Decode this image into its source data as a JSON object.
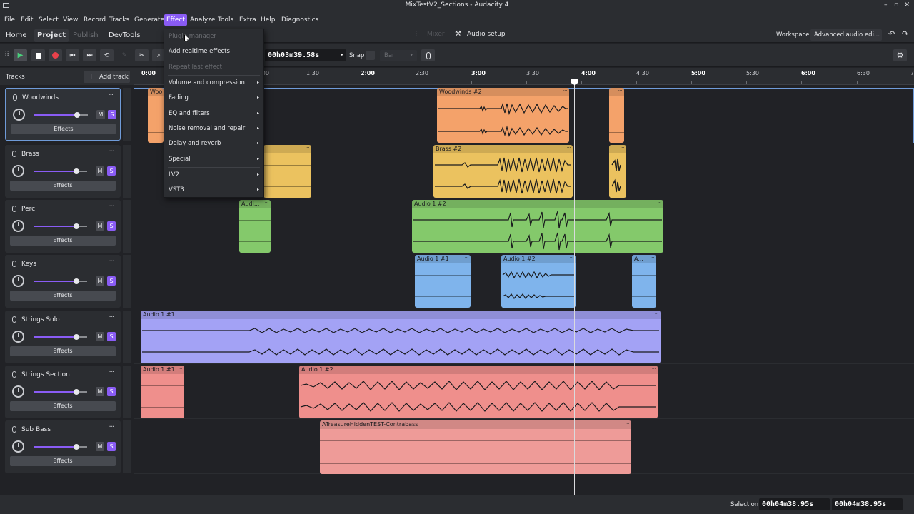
{
  "window": {
    "title": "MixTestV2_Sections - Audacity 4"
  },
  "menu": [
    "File",
    "Edit",
    "Select",
    "View",
    "Record",
    "Tracks",
    "Generate",
    "Effect",
    "Analyze",
    "Tools",
    "Extra",
    "Help",
    "Diagnostics"
  ],
  "nav": {
    "tabs": [
      "Home",
      "Project",
      "Publish",
      "DevTools"
    ],
    "mixer": "Mixer",
    "audio_setup": "Audio setup",
    "workspace_label": "Workspace",
    "workspace_value": "Advanced audio edi..."
  },
  "toolbar": {
    "time": "00h03m39.58s",
    "snap_label": "Snap",
    "snap_value": "Bar"
  },
  "tracks_header": {
    "label": "Tracks",
    "add_track": "Add track"
  },
  "ruler": {
    "labels": [
      "0:00",
      "1:00",
      "1:30",
      "2:00",
      "2:30",
      "3:00",
      "3:30",
      "4:00",
      "4:30",
      "5:00",
      "5:30",
      "6:00",
      "6:30",
      "7"
    ]
  },
  "tracks": [
    {
      "name": "Woodwinds",
      "mute": "M",
      "solo": "S",
      "effects": "Effects",
      "volume": 0.8
    },
    {
      "name": "Brass",
      "mute": "M",
      "solo": "S",
      "effects": "Effects",
      "volume": 0.8
    },
    {
      "name": "Perc",
      "mute": "M",
      "solo": "S",
      "effects": "Effects",
      "volume": 0.8
    },
    {
      "name": "Keys",
      "mute": "M",
      "solo": "S",
      "effects": "Effects",
      "volume": 0.8
    },
    {
      "name": "Strings Solo",
      "mute": "M",
      "solo": "S",
      "effects": "Effects",
      "volume": 0.8
    },
    {
      "name": "Strings Section",
      "mute": "M",
      "solo": "S",
      "effects": "Effects",
      "volume": 0.8
    },
    {
      "name": "Sub Bass",
      "mute": "M",
      "solo": "S",
      "effects": "Effects",
      "volume": 0.8
    }
  ],
  "clips": {
    "woodwinds_1": "Woo",
    "woodwinds_2": "Woodwinds #2",
    "brass_2": "Brass #2",
    "perc_1": "Audi...",
    "perc_2": "Audio 1 #2",
    "keys_1": "Audio 1 #1",
    "keys_2": "Audio 1 #2",
    "keys_3": "A...",
    "strings_solo_1": "Audio 1 #1",
    "strings_section_1": "Audio 1 #1",
    "strings_section_2": "Audio 1 #2",
    "sub_bass_1": "ATreasureHiddenTEST-Contrabass"
  },
  "clip_colors": {
    "woodwinds": "#f4a26a",
    "brass": "#ebc25f",
    "perc": "#84c96b",
    "keys": "#7fb4ec",
    "strings_solo": "#a3a2f5",
    "strings_section": "#ef8f8c",
    "sub_bass": "#ee9b98"
  },
  "effect_menu": {
    "items": [
      {
        "label": "Plugin manager",
        "disabled": true,
        "submenu": false
      },
      {
        "label": "Add realtime effects",
        "disabled": false,
        "submenu": false
      },
      {
        "label": "Repeat last effect",
        "disabled": true,
        "submenu": false
      },
      {
        "label": "Volume and compression",
        "disabled": false,
        "submenu": true
      },
      {
        "label": "Fading",
        "disabled": false,
        "submenu": true
      },
      {
        "label": "EQ and filters",
        "disabled": false,
        "submenu": true
      },
      {
        "label": "Noise removal and repair",
        "disabled": false,
        "submenu": true
      },
      {
        "label": "Delay and reverb",
        "disabled": false,
        "submenu": true
      },
      {
        "label": "Special",
        "disabled": false,
        "submenu": true
      },
      {
        "label": "LV2",
        "disabled": false,
        "submenu": true
      },
      {
        "label": "VST3",
        "disabled": false,
        "submenu": true
      }
    ]
  },
  "status": {
    "selection_label": "Selection",
    "start": "00h04m38.95s",
    "end": "00h04m38.95s"
  }
}
